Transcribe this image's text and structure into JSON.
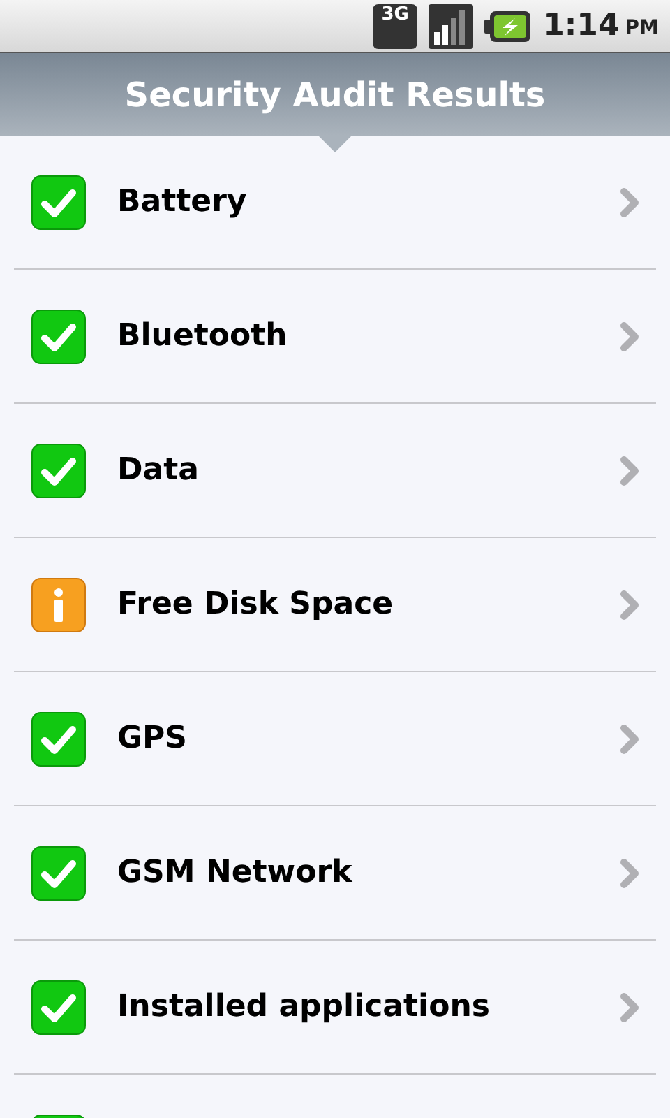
{
  "status_bar": {
    "network": "3G",
    "time": "1:14",
    "period": "PM"
  },
  "header": {
    "title": "Security Audit Results"
  },
  "items": [
    {
      "label": "Battery",
      "kind": "check"
    },
    {
      "label": "Bluetooth",
      "kind": "check"
    },
    {
      "label": "Data",
      "kind": "check"
    },
    {
      "label": "Free Disk Space",
      "kind": "info"
    },
    {
      "label": "GPS",
      "kind": "check"
    },
    {
      "label": "GSM Network",
      "kind": "check"
    },
    {
      "label": "Installed applications",
      "kind": "check"
    },
    {
      "kind": "check"
    }
  ]
}
